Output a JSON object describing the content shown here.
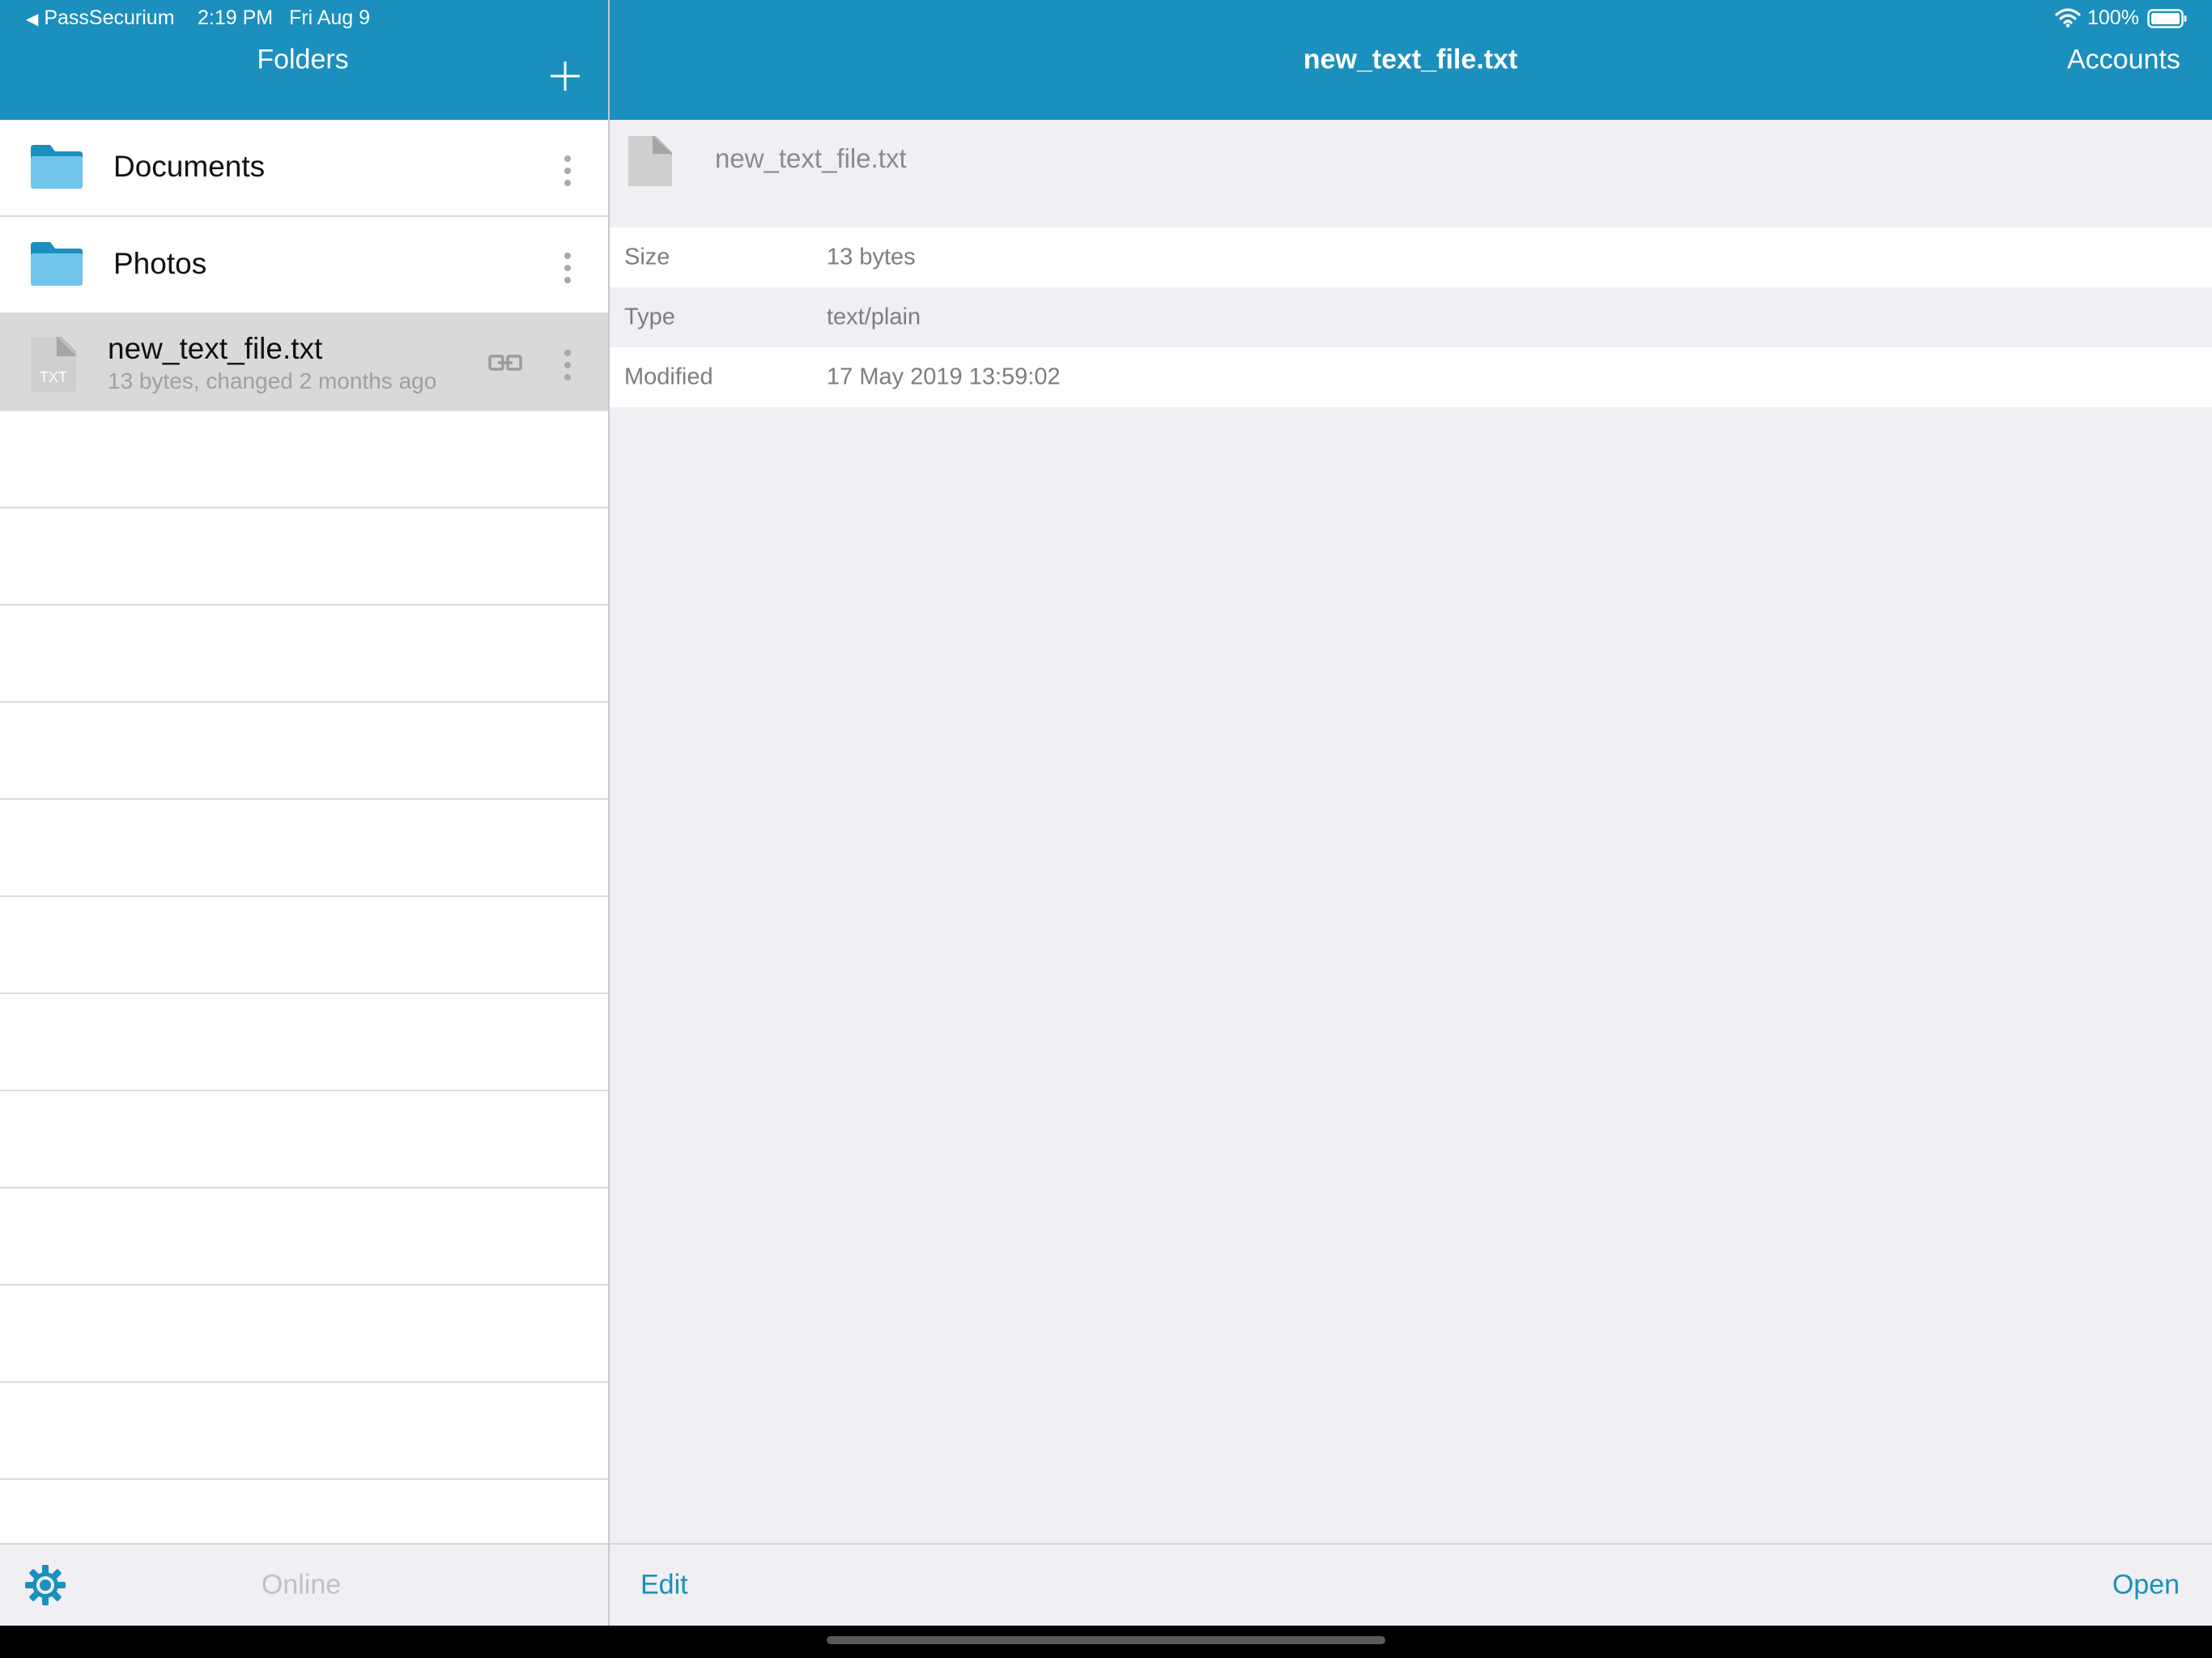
{
  "status_bar": {
    "back_app": "PassSecurium",
    "time": "2:19 PM",
    "date": "Fri Aug 9",
    "battery": "100%"
  },
  "sidebar": {
    "title": "Folders",
    "items": [
      {
        "type": "folder",
        "label": "Documents"
      },
      {
        "type": "folder",
        "label": "Photos"
      },
      {
        "type": "file",
        "label": "new_text_file.txt",
        "subtitle": "13 bytes, changed 2 months ago",
        "file_badge": "TXT",
        "selected": true
      }
    ],
    "toolbar": {
      "status": "Online"
    }
  },
  "detail": {
    "title": "new_text_file.txt",
    "accounts_label": "Accounts",
    "header_filename": "new_text_file.txt",
    "properties": [
      {
        "label": "Size",
        "value": "13 bytes"
      },
      {
        "label": "Type",
        "value": "text/plain"
      },
      {
        "label": "Modified",
        "value": "17 May 2019 13:59:02"
      }
    ],
    "toolbar": {
      "edit_label": "Edit",
      "open_label": "Open"
    }
  },
  "colors": {
    "accent": "#1b8fbd",
    "folder_light": "#72c5ea",
    "folder_dark": "#1b8fbd",
    "background": "#f0eff4",
    "selected_row": "#d9d9d9"
  }
}
